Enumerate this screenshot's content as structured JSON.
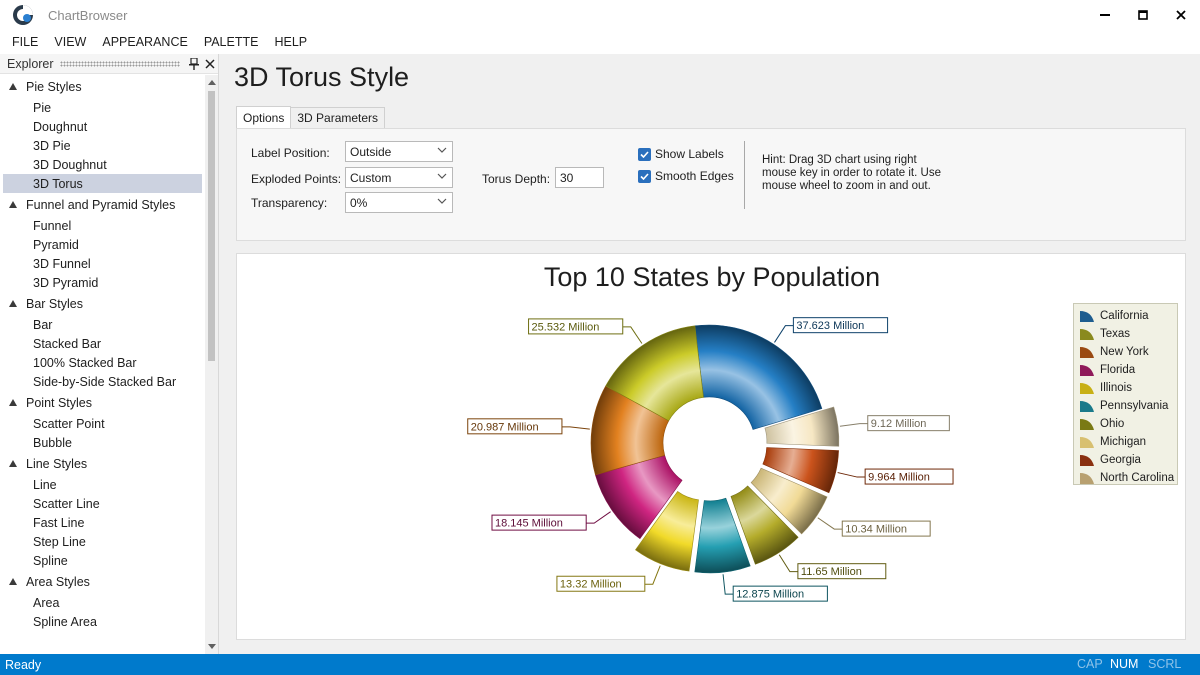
{
  "window": {
    "title": "ChartBrowser"
  },
  "menu": [
    "FILE",
    "VIEW",
    "APPEARANCE",
    "PALETTE",
    "HELP"
  ],
  "explorer": {
    "title": "Explorer",
    "groups": [
      {
        "label": "Pie Styles",
        "items": [
          "Pie",
          "Doughnut",
          "3D Pie",
          "3D Doughnut",
          "3D Torus"
        ]
      },
      {
        "label": "Funnel and Pyramid Styles",
        "items": [
          "Funnel",
          "Pyramid",
          "3D Funnel",
          "3D Pyramid"
        ]
      },
      {
        "label": "Bar Styles",
        "items": [
          "Bar",
          "Stacked Bar",
          "100% Stacked Bar",
          "Side-by-Side Stacked Bar"
        ]
      },
      {
        "label": "Point Styles",
        "items": [
          "Scatter Point",
          "Bubble"
        ]
      },
      {
        "label": "Line Styles",
        "items": [
          "Line",
          "Scatter Line",
          "Fast Line",
          "Step Line",
          "Spline"
        ]
      },
      {
        "label": "Area Styles",
        "items": [
          "Area",
          "Spline Area"
        ]
      }
    ],
    "selected": "3D Torus"
  },
  "page": {
    "title": "3D Torus Style",
    "tabs": [
      "Options",
      "3D Parameters"
    ],
    "active_tab": "Options"
  },
  "options": {
    "label_position_label": "Label Position:",
    "label_position_value": "Outside",
    "exploded_points_label": "Exploded Points:",
    "exploded_points_value": "Custom",
    "transparency_label": "Transparency:",
    "transparency_value": "0%",
    "torus_depth_label": "Torus Depth:",
    "torus_depth_value": "30",
    "show_labels_label": "Show Labels",
    "show_labels_checked": true,
    "smooth_edges_label": "Smooth Edges",
    "smooth_edges_checked": true,
    "hint": "Hint: Drag 3D chart using right mouse key in order to rotate it. Use mouse wheel to zoom in and out."
  },
  "chart_data": {
    "type": "pie",
    "subtype": "3D torus",
    "title": "Top 10 States by Population",
    "unit": "Million",
    "categories": [
      "California",
      "Texas",
      "New York",
      "Florida",
      "Illinois",
      "Pennsylvania",
      "Ohio",
      "Michigan",
      "Georgia",
      "North Carolina"
    ],
    "values": [
      37.623,
      25.532,
      20.987,
      18.145,
      13.32,
      12.875,
      11.65,
      10.34,
      9.964,
      9.12
    ],
    "labels": [
      "37.623 Million",
      "25.532 Million",
      "20.987 Million",
      "18.145 Million",
      "13.32 Million",
      "12.875 Million",
      "11.65 Million",
      "10.34 Million",
      "9.964 Million",
      "9.12 Million"
    ],
    "colors": [
      "#1a78c2",
      "#c8c81e",
      "#e07a14",
      "#cc1a7a",
      "#f0d81e",
      "#1a9aae",
      "#b0a820",
      "#f0d890",
      "#c84a10",
      "#f5e6c0"
    ],
    "legend": {
      "entries": [
        "California",
        "Texas",
        "New York",
        "Florida",
        "Illinois",
        "Pennsylvania",
        "Ohio",
        "Michigan",
        "Georgia",
        "North Carolina"
      ],
      "colors": [
        "#1e5d8f",
        "#8a8a1e",
        "#9a4a12",
        "#8f1a5a",
        "#c8b014",
        "#1a7a8a",
        "#7a7a14",
        "#d8c070",
        "#8a3010",
        "#b8a070"
      ],
      "placement": "right"
    }
  },
  "status": {
    "text": "Ready",
    "cap": "CAP",
    "num": "NUM",
    "scrl": "SCRL"
  }
}
